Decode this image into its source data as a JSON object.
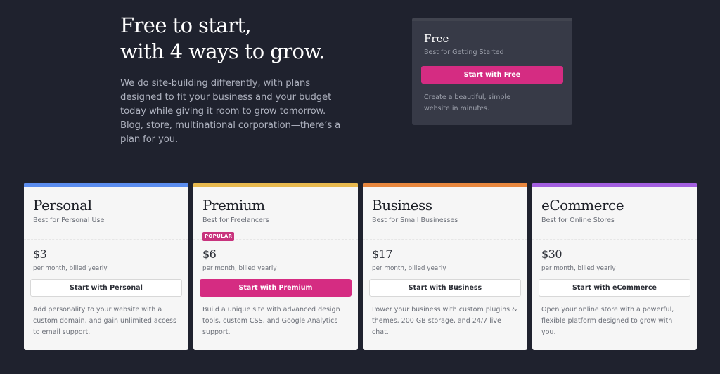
{
  "hero": {
    "title_line1": "Free to start,",
    "title_line2": "with 4 ways to grow.",
    "description": "We do site-building differently, with plans designed to fit your business and your budget today while giving it room to grow tomorrow. Blog, store, multinational corporation—there’s a plan for you."
  },
  "free_plan": {
    "name": "Free",
    "subtitle": "Best for Getting Started",
    "button_label": "Start with Free",
    "description": "Create a beautiful, simple website in minutes."
  },
  "colors": {
    "background": "#1f222e",
    "accent_pink": "#d52c82",
    "personal": "#5b8def",
    "premium": "#e8b94e",
    "business": "#e8873e",
    "ecommerce": "#a35fe0"
  },
  "plans": [
    {
      "name": "Personal",
      "subtitle": "Best for Personal Use",
      "badge": "",
      "price": "$3",
      "price_note": "per month, billed yearly",
      "button_label": "Start with Personal",
      "description": "Add personality to your website with a custom domain, and gain unlimited access to email support.",
      "accent": "#5b8def"
    },
    {
      "name": "Premium",
      "subtitle": "Best for Freelancers",
      "badge": "POPULAR",
      "price": "$6",
      "price_note": "per month, billed yearly",
      "button_label": "Start with Premium",
      "description": "Build a unique site with advanced design tools, custom CSS, and Google Analytics support.",
      "accent": "#e8b94e"
    },
    {
      "name": "Business",
      "subtitle": "Best for Small Businesses",
      "badge": "",
      "price": "$17",
      "price_note": "per month, billed yearly",
      "button_label": "Start with Business",
      "description": "Power your business with custom plugins & themes, 200 GB storage, and 24/7 live chat.",
      "accent": "#e8873e"
    },
    {
      "name": "eCommerce",
      "subtitle": "Best for Online Stores",
      "badge": "",
      "price": "$30",
      "price_note": "per month, billed yearly",
      "button_label": "Start with eCommerce",
      "description": "Open your online store with a powerful, flexible platform designed to grow with you.",
      "accent": "#a35fe0"
    }
  ]
}
